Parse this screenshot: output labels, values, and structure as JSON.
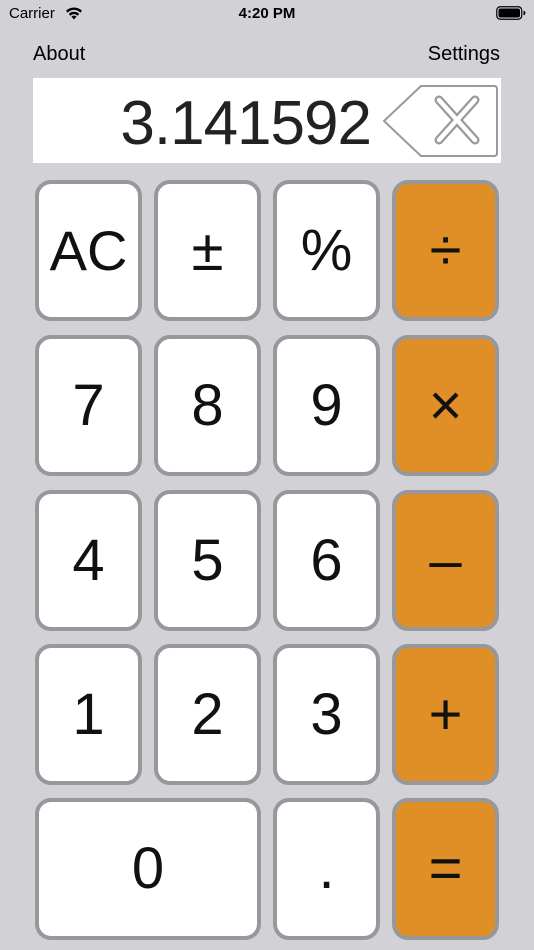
{
  "status_bar": {
    "carrier": "Carrier",
    "time": "4:20 PM"
  },
  "nav": {
    "about": "About",
    "settings": "Settings"
  },
  "display": {
    "value": "3.141592"
  },
  "keys": {
    "clear": "AC",
    "sign": "±",
    "percent": "%",
    "divide": "÷",
    "seven": "7",
    "eight": "8",
    "nine": "9",
    "multiply": "×",
    "four": "4",
    "five": "5",
    "six": "6",
    "subtract": "–",
    "one": "1",
    "two": "2",
    "three": "3",
    "add": "+",
    "zero": "0",
    "decimal": ".",
    "equals": "="
  },
  "colors": {
    "background": "#d1d1d6",
    "operator": "#e08e26",
    "key_border": "#98989c"
  }
}
